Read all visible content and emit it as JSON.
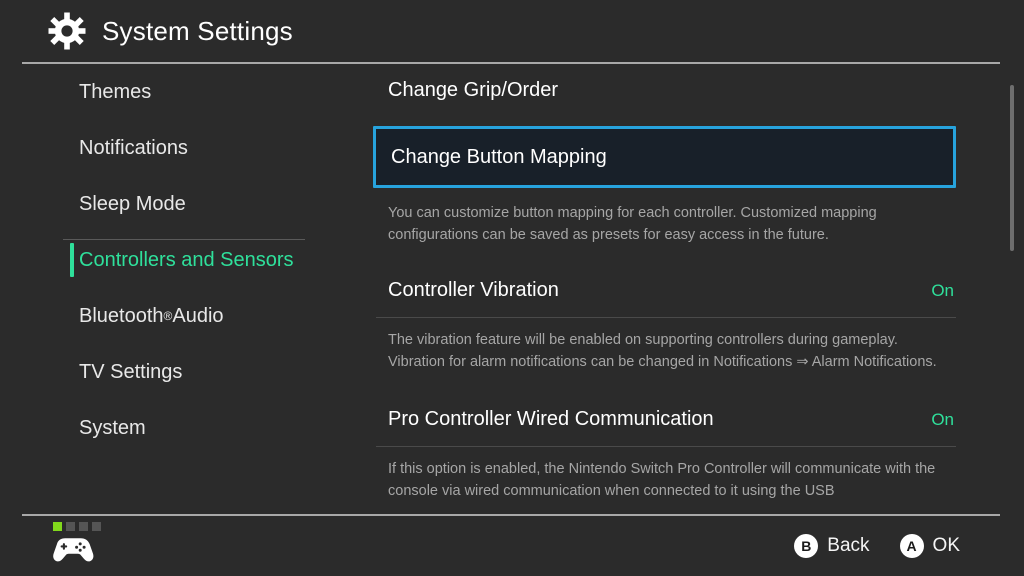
{
  "header": {
    "title": "System Settings",
    "icon": "gear-icon"
  },
  "sidebar": {
    "items": [
      {
        "label": "Themes",
        "active": false
      },
      {
        "label": "Notifications",
        "active": false
      },
      {
        "label": "Sleep Mode",
        "active": false
      },
      {
        "label": "Controllers and Sensors",
        "active": true
      },
      {
        "label": "Bluetooth",
        "suffix": "®",
        "label_tail": " Audio",
        "active": false
      },
      {
        "label": "TV Settings",
        "active": false
      },
      {
        "label": "System",
        "active": false
      }
    ]
  },
  "content": {
    "rows": [
      {
        "title": "Change Grip/Order",
        "value": "",
        "description": "",
        "selected": false
      },
      {
        "title": "Change Button Mapping",
        "value": "",
        "description": "You can customize button mapping for each controller. Customized mapping configurations can be saved as presets for easy access in the future.",
        "selected": true
      },
      {
        "title": "Controller Vibration",
        "value": "On",
        "description": "The vibration feature will be enabled on supporting controllers during gameplay. Vibration for alarm notifications can be changed in Notifications ⇒ Alarm Notifications.",
        "selected": false
      },
      {
        "title": "Pro Controller Wired Communication",
        "value": "On",
        "description": "If this option is enabled, the Nintendo Switch Pro Controller will communicate with the console via wired communication when connected to it using the USB",
        "selected": false
      }
    ]
  },
  "footer": {
    "player_leds": [
      true,
      false,
      false,
      false
    ],
    "controller_icon": "gamepad-icon",
    "hints": [
      {
        "button": "B",
        "label": "Back"
      },
      {
        "button": "A",
        "label": "OK"
      }
    ]
  },
  "colors": {
    "accent_green": "#2fe09b",
    "selection_border": "#27a3dd",
    "selection_fill": "#182029",
    "led_on": "#82d91c",
    "background": "#2b2b2b"
  }
}
